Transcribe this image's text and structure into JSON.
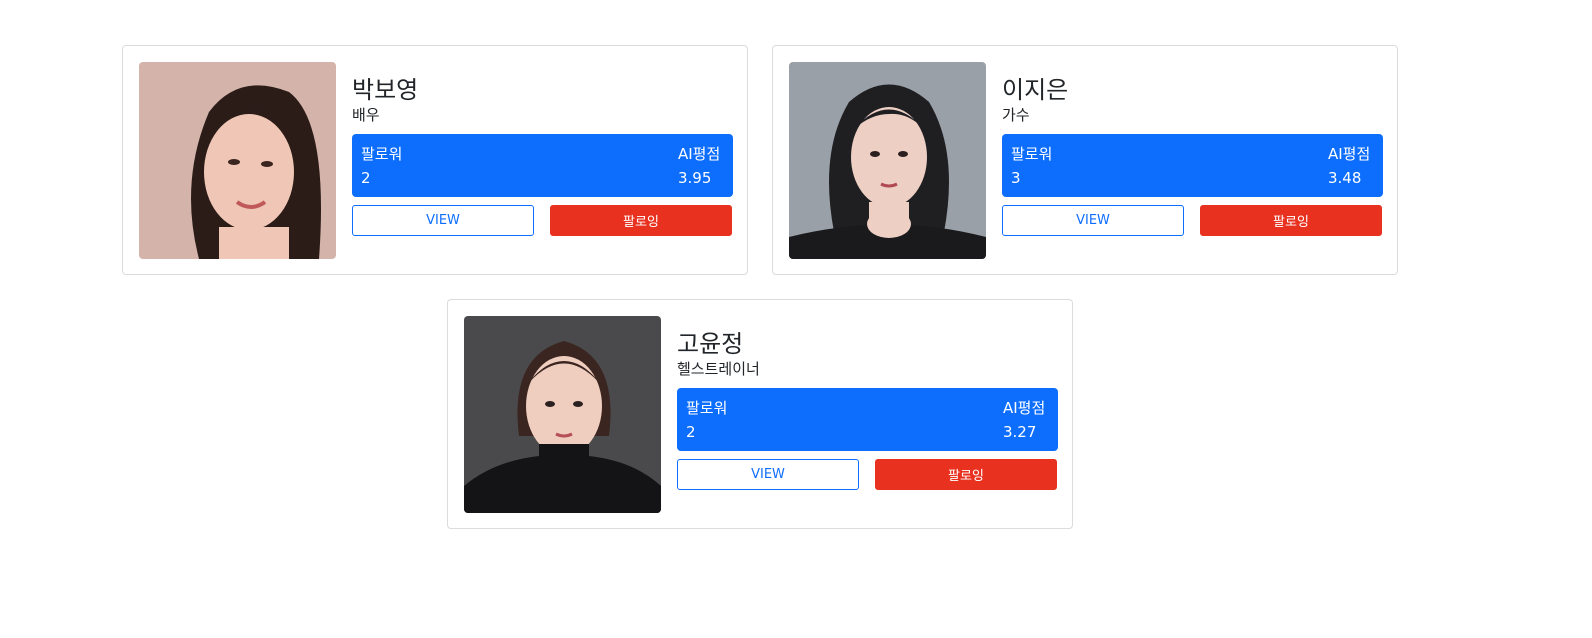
{
  "labels": {
    "followers": "팔로워",
    "ai_rating": "AI평점",
    "view_button": "VIEW",
    "follow_button": "팔로잉"
  },
  "colors": {
    "stats_bg": "#0d6efd",
    "view_border": "#0d6efd",
    "follow_bg": "#e8311f"
  },
  "profiles": [
    {
      "name": "박보영",
      "job": "배우",
      "followers": "2",
      "rating": "3.95"
    },
    {
      "name": "이지은",
      "job": "가수",
      "followers": "3",
      "rating": "3.48"
    },
    {
      "name": "고윤정",
      "job": "헬스트레이너",
      "followers": "2",
      "rating": "3.27"
    }
  ]
}
